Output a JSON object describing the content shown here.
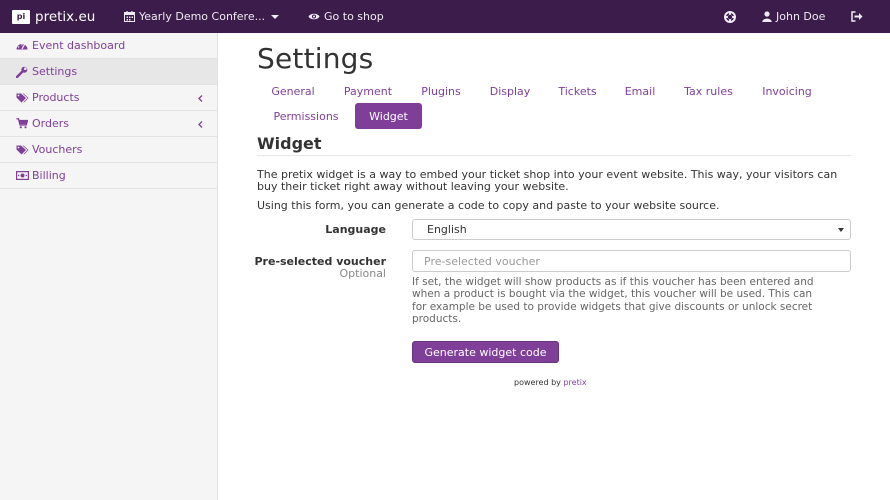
{
  "navbar": {
    "brand_logo": "pi",
    "brand": "pretix.eu",
    "event_selector": "Yearly Demo Confere...",
    "go_to_shop": "Go to shop",
    "user": "John Doe",
    "bg_color": "#3b1c4a"
  },
  "sidebar": {
    "items": [
      {
        "label": "Event dashboard",
        "icon": "dashboard-icon"
      },
      {
        "label": "Settings",
        "icon": "wrench-icon",
        "active": true
      },
      {
        "label": "Products",
        "icon": "tags-icon",
        "expandable": true
      },
      {
        "label": "Orders",
        "icon": "cart-icon",
        "expandable": true
      },
      {
        "label": "Vouchers",
        "icon": "tags-icon"
      },
      {
        "label": "Billing",
        "icon": "money-icon"
      }
    ]
  },
  "main": {
    "title": "Settings",
    "tabs": [
      "General",
      "Payment",
      "Plugins",
      "Display",
      "Tickets",
      "Email",
      "Tax rules",
      "Invoicing",
      "Permissions",
      "Widget"
    ],
    "active_tab": "Widget",
    "section_title": "Widget",
    "intro_line1": "The pretix widget is a way to embed your ticket shop into your event website. This way, your visitors can",
    "intro_line2": "buy their ticket right away without leaving your website.",
    "intro_line3": "Using this form, you can generate a code to copy and paste to your website source.",
    "form": {
      "language_label": "Language",
      "language_value": "English",
      "voucher_label": "Pre-selected voucher",
      "voucher_optional": "Optional",
      "voucher_placeholder": "Pre-selected voucher",
      "help_line1": "If set, the widget will show products as if this voucher has been entered and",
      "help_line2": "when a product is bought via the widget, this voucher will be used. This can",
      "help_line3": "for example be used to provide widgets that give discounts or unlock secret",
      "help_line4": "products.",
      "submit_label": "Generate widget code"
    },
    "footer_text": "powered by",
    "footer_link": "pretix"
  },
  "colors": {
    "accent": "#7f3f98",
    "nav_bg": "#3b1c4a"
  }
}
